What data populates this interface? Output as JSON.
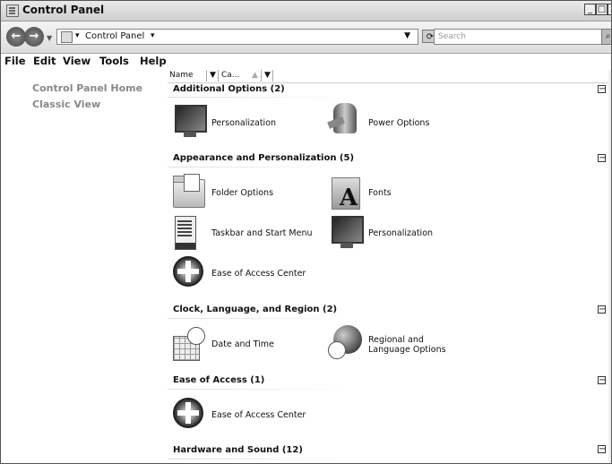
{
  "window": {
    "title": "Control Panel"
  },
  "address": {
    "breadcrumb": "Control Panel",
    "search_placeholder": "Search"
  },
  "menu": [
    "File",
    "Edit",
    "View",
    "Tools",
    "Help"
  ],
  "left_pane": {
    "links": [
      "Control Panel Home",
      "Classic View"
    ]
  },
  "columns": {
    "name": "Name",
    "category": "Ca..."
  },
  "groups": [
    {
      "title": "Additional Options (2)",
      "items": [
        "Personalization",
        "Power Options"
      ]
    },
    {
      "title": "Appearance and Personalization (5)",
      "items": [
        "Folder Options",
        "Fonts",
        "Taskbar and Start Menu",
        "Personalization",
        "Ease of Access Center"
      ]
    },
    {
      "title": "Clock, Language, and Region (2)",
      "items": [
        "Date and Time",
        "Regional and Language Options"
      ]
    },
    {
      "title": "Ease of Access (1)",
      "items": [
        "Ease of Access Center"
      ]
    },
    {
      "title": "Hardware and Sound (12)",
      "items": []
    }
  ]
}
